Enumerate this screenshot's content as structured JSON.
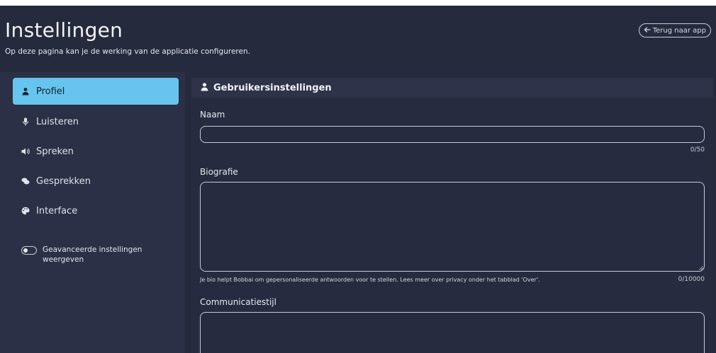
{
  "header": {
    "title": "Instellingen",
    "subtitle": "Op deze pagina kan je de werking van de applicatie configureren.",
    "back_button": "Terug naar app"
  },
  "sidebar": {
    "items": [
      {
        "label": "Profiel",
        "icon": "user-icon",
        "active": true
      },
      {
        "label": "Luisteren",
        "icon": "microphone-icon",
        "active": false
      },
      {
        "label": "Spreken",
        "icon": "speaker-icon",
        "active": false
      },
      {
        "label": "Gesprekken",
        "icon": "chat-bubbles-icon",
        "active": false
      },
      {
        "label": "Interface",
        "icon": "palette-icon",
        "active": false
      }
    ],
    "advanced_toggle": {
      "label": "Geavanceerde instellingen weergeven",
      "checked": false
    }
  },
  "panel": {
    "title": "Gebruikersinstellingen",
    "name_field": {
      "label": "Naam",
      "value": "",
      "counter": "0/50"
    },
    "bio_field": {
      "label": "Biografie",
      "value": "",
      "hint": "Je bio helpt Bobbai om gepersonaliseerde antwoorden voor te stellen. Lees meer over privacy onder het tabblad 'Over'.",
      "counter": "0/10000"
    },
    "style_field": {
      "label": "Communicatiestijl",
      "value": ""
    }
  },
  "colors": {
    "background": "#262a3d",
    "sidebar": "#2b3046",
    "active_item": "#67c4ef",
    "panel_header": "#2e3349"
  }
}
